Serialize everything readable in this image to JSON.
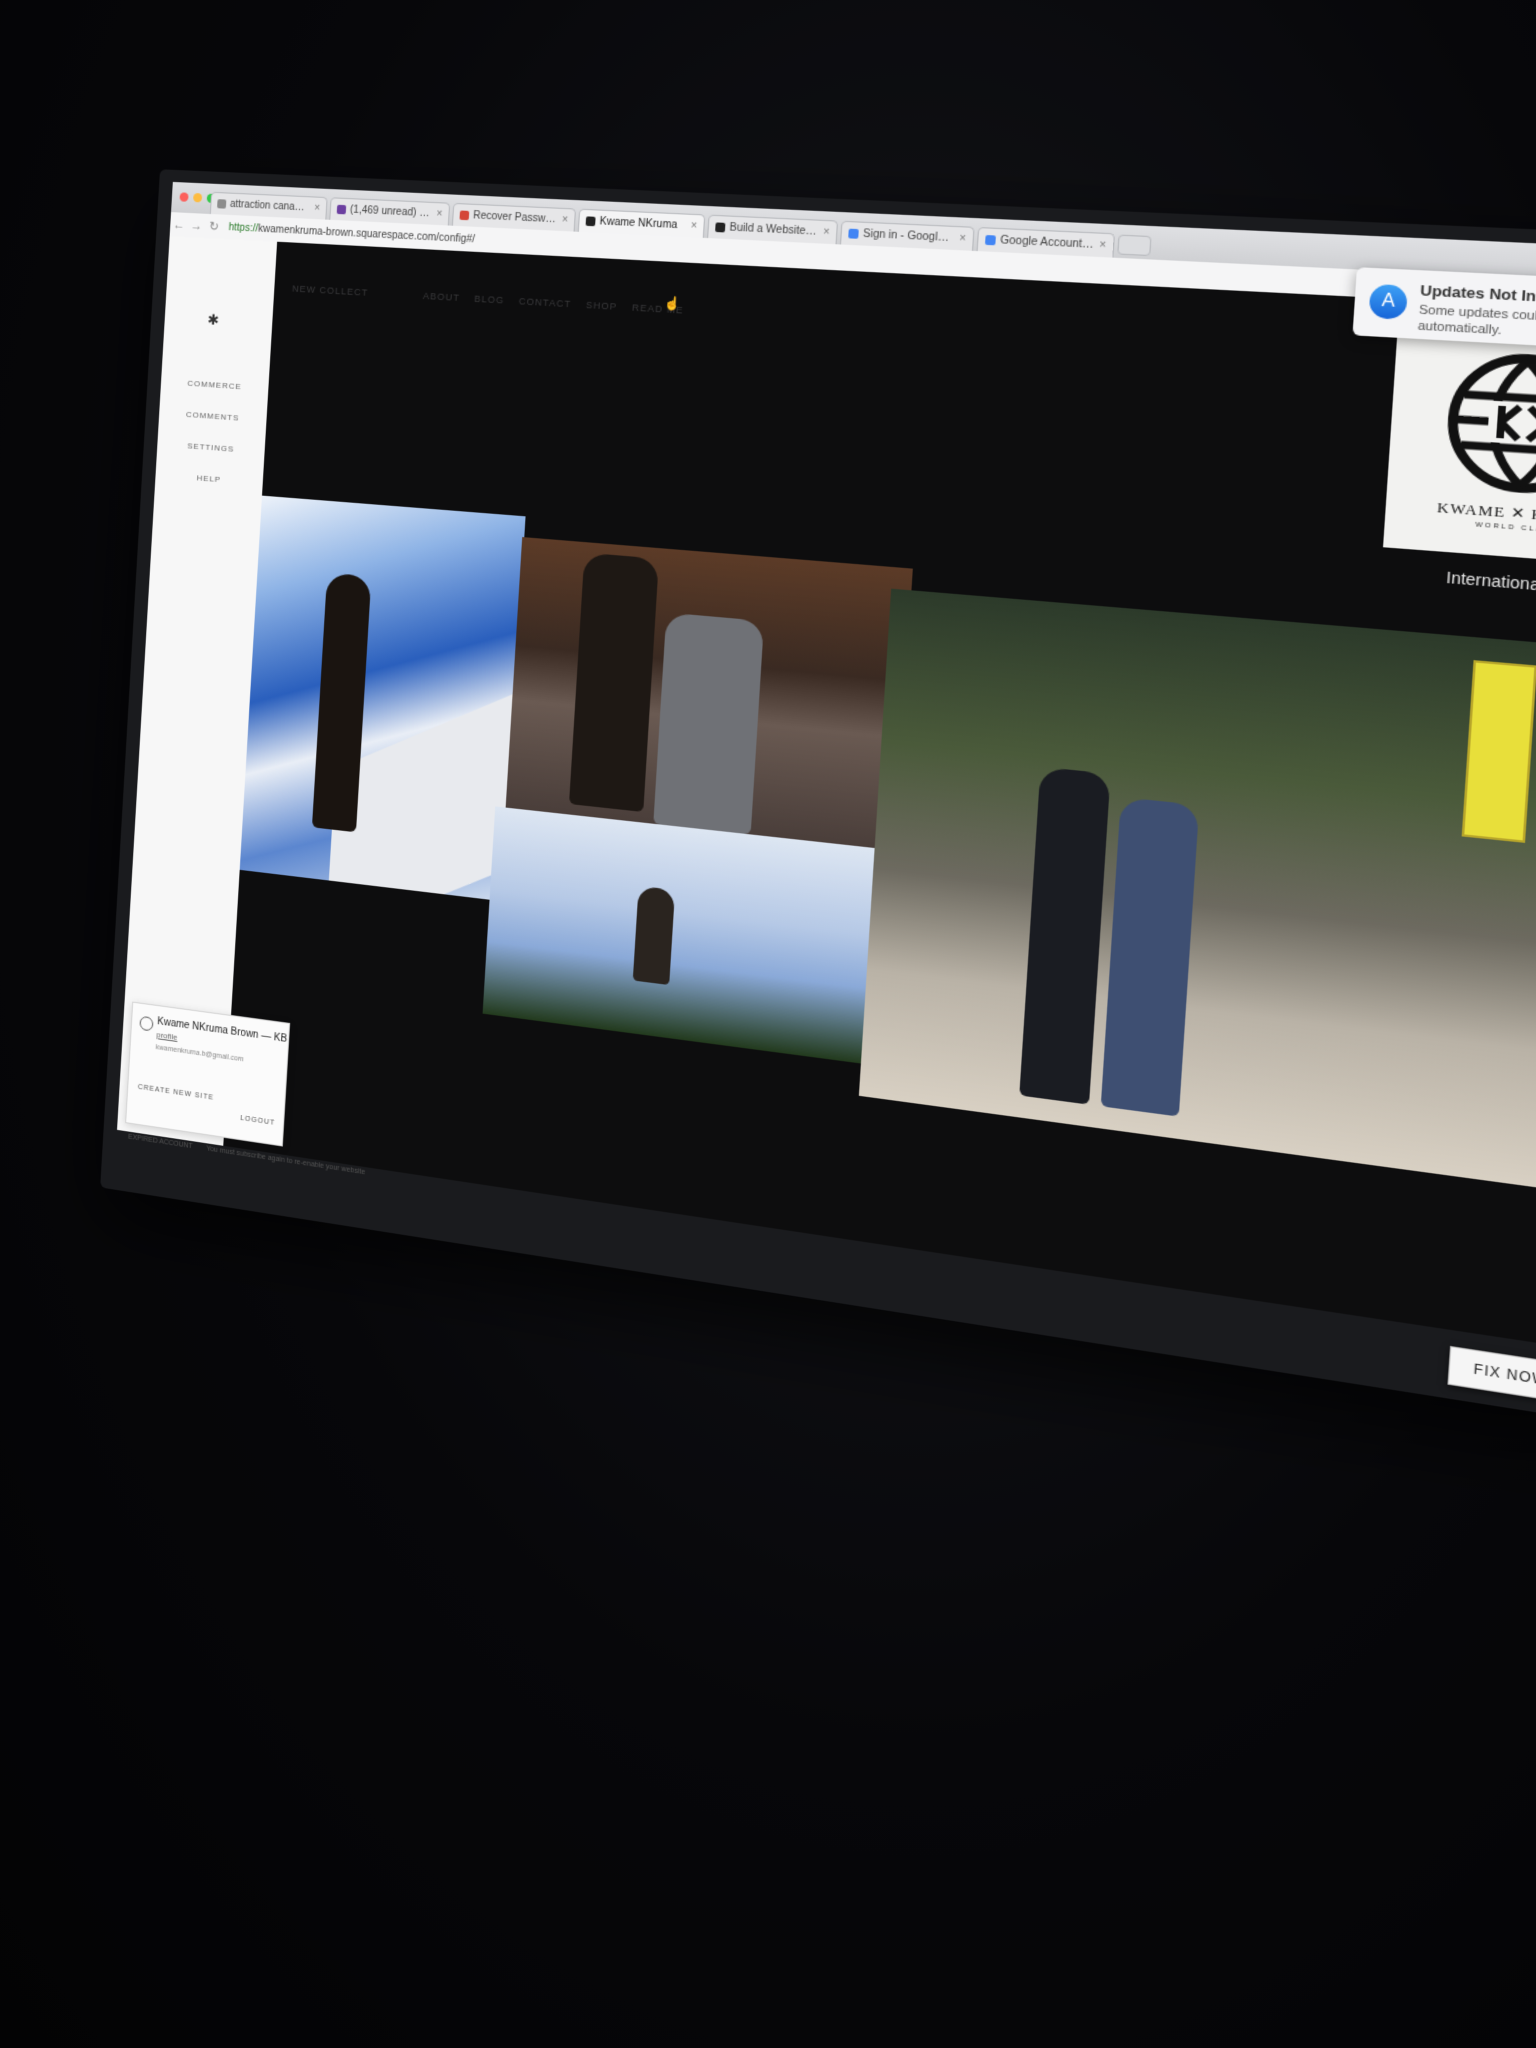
{
  "browser": {
    "tabs": [
      {
        "label": "attraction canada flights",
        "active": false,
        "favicon_color": "#8c8c8c"
      },
      {
        "label": "(1,469 unread) - kwame",
        "active": false,
        "favicon_color": "#6b3fa0"
      },
      {
        "label": "Recover Password - Kwam",
        "active": false,
        "favicon_color": "#d44638"
      },
      {
        "label": "Kwame NKruma",
        "active": true,
        "favicon_color": "#222222"
      },
      {
        "label": "Build a Website — Square",
        "active": false,
        "favicon_color": "#222222"
      },
      {
        "label": "Sign in - Google Accounts",
        "active": false,
        "favicon_color": "#4285f4"
      },
      {
        "label": "Google Account Recovery",
        "active": false,
        "favicon_color": "#4285f4"
      }
    ],
    "url_scheme": "https://",
    "url_rest": "kwamenkruma-brown.squarespace.com/config#/"
  },
  "sidebar": {
    "logo_glyph": "✱",
    "menu": [
      "COMMERCE",
      "COMMENTS",
      "SETTINGS",
      "HELP"
    ]
  },
  "account": {
    "name": "Kwame NKruma Brown — KB",
    "profile_link": "profile",
    "email": "kwamenkruma.b@gmail.com",
    "create_site": "CREATE NEW SITE",
    "logout": "LOGOUT",
    "expired_label": "EXPIRED ACCOUNT",
    "expired_message": "You must subscribe again to re-enable your website"
  },
  "site": {
    "nav": [
      "NEW COLLECT",
      "ABOUT",
      "BLOG",
      "CONTACT",
      "SHOP",
      "READ ME"
    ],
    "logo_wordmark": "KWAME ✕ KRUMA",
    "logo_sub": "WORLD CLASS",
    "tagline": "International Fashion"
  },
  "fix_now": "FIX NOW",
  "notification": {
    "title": "Updates Not Installed",
    "body": "Some updates could not be installed automatically.",
    "icon": "app-store-icon"
  }
}
